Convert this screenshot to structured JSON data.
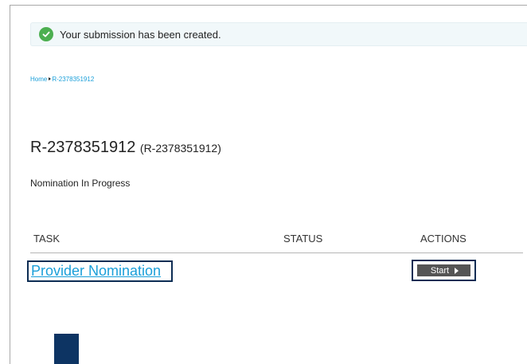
{
  "alert": {
    "message": "Your submission has been created.",
    "icon": "check-circle-icon",
    "icon_color": "#4caf50"
  },
  "breadcrumb": {
    "home": "Home",
    "current": "R-2378351912"
  },
  "page": {
    "title": "R-2378351912",
    "subtitle": "(R-2378351912)",
    "status": "Nomination In Progress"
  },
  "table": {
    "headers": {
      "task": "TASK",
      "status": "STATUS",
      "actions": "ACTIONS"
    },
    "rows": [
      {
        "task": "Provider Nomination",
        "status": "",
        "action": "Start"
      }
    ]
  },
  "colors": {
    "link": "#1a9fd9",
    "focus_outline": "#0d2d54",
    "button_bg": "#555555",
    "block": "#0d3463"
  }
}
